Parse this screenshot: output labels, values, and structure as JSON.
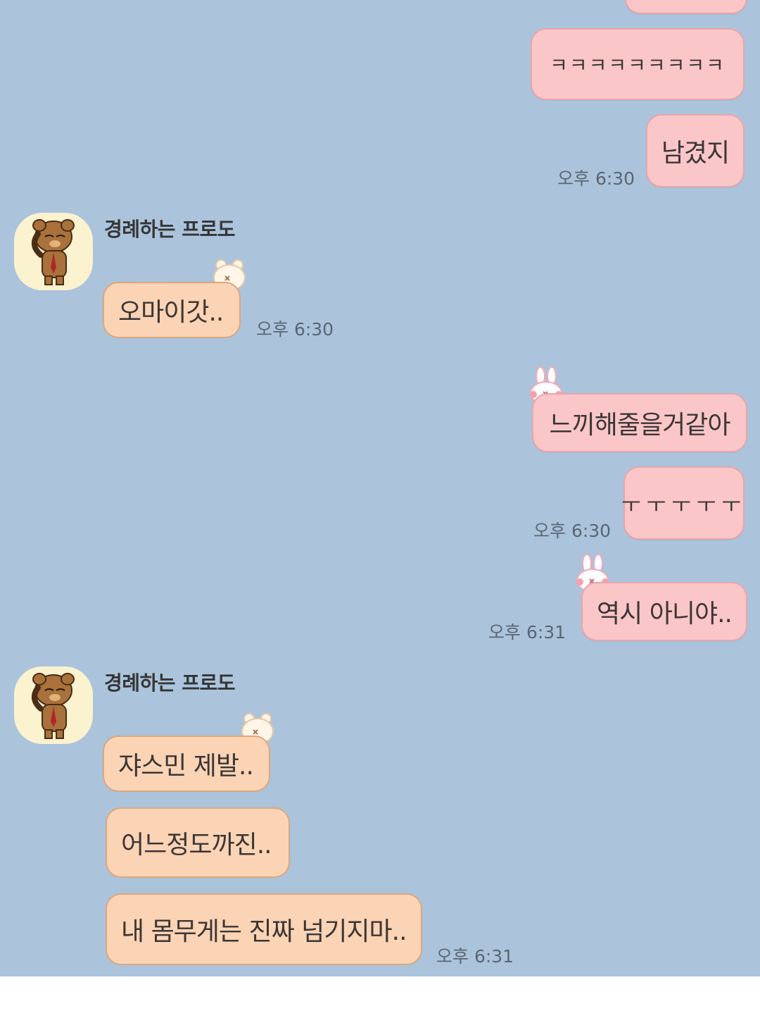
{
  "chat": {
    "messages_out_1": {
      "m1": "ㅋㅋㅋㅋㅋㅋㅋㅋㅋ",
      "m2": "남겼지",
      "time": "오후 6:30"
    },
    "block_in_1": {
      "sender": "경례하는 프로도",
      "m1": "오마이갓..",
      "time": "오후 6:30"
    },
    "messages_out_2": {
      "m1": "느끼해줄을거같아",
      "m2": "ㅜㅜㅜㅜㅜ",
      "time": "오후 6:30"
    },
    "messages_out_3": {
      "m1": "역시 아니야..",
      "time": "오후 6:31"
    },
    "block_in_2": {
      "sender": "경례하는 프로도",
      "m1": "쟈스민 제발..",
      "m2": "어느정도까진..",
      "m3": "내 몸무게는 진짜 넘기지마..",
      "time": "오후 6:31"
    }
  },
  "icons": {
    "avatar": "frodo-saluting-avatar-icon",
    "bear_sticker": "bear-sticker-icon",
    "bunny_sticker": "bunny-sticker-icon"
  },
  "colors": {
    "chat_background": "#abc4dc",
    "outgoing_bubble": "#fbc6c8",
    "incoming_bubble": "#fbd3b5",
    "avatar_background": "#fbf2d0"
  }
}
